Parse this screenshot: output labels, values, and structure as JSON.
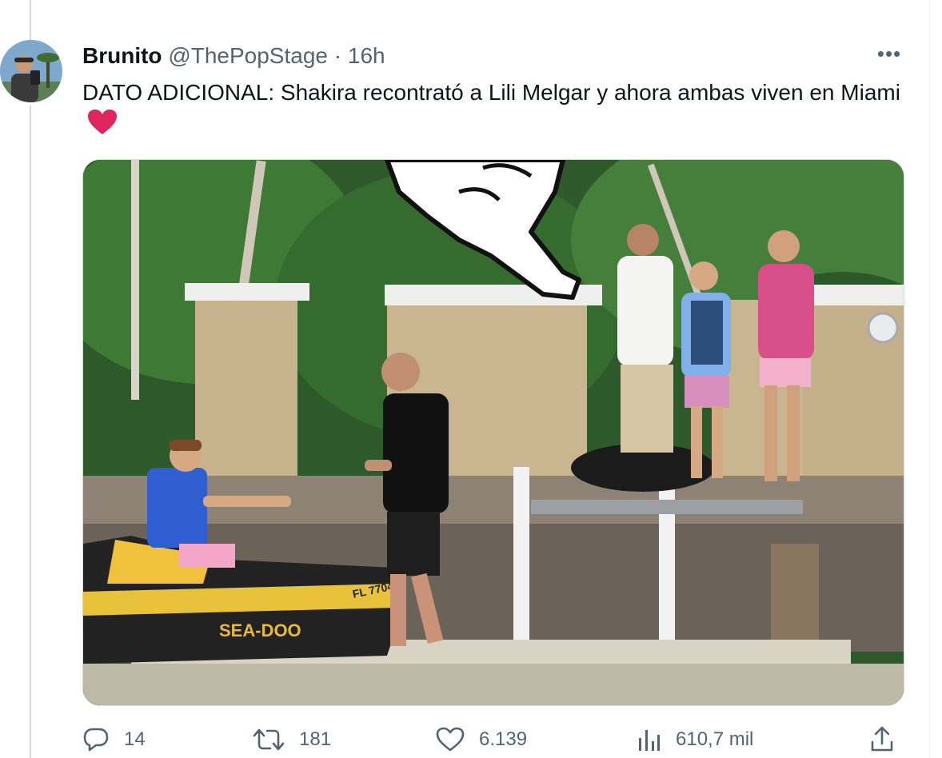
{
  "tweet": {
    "author_name": "Brunito",
    "handle": "@ThePopStage",
    "separator": "·",
    "time": "16h",
    "more_label": "•••",
    "text": "DATO ADICIONAL: Shakira recontrató a Lili Melgar y ahora ambas viven en Miami",
    "emoji": "red-heart"
  },
  "media": {
    "jetski_brand": "SEA-DOO",
    "jetski_reg": "FL 7704TF"
  },
  "actions": {
    "replies": "14",
    "retweets": "181",
    "likes": "6.139",
    "views": "610,7 mil",
    "reply_icon": "reply-icon",
    "retweet_icon": "retweet-icon",
    "like_icon": "heart-icon",
    "views_icon": "views-chart-icon",
    "share_icon": "share-icon"
  },
  "colors": {
    "icon_gray": "#536471",
    "heart_red": "#e0245e"
  }
}
